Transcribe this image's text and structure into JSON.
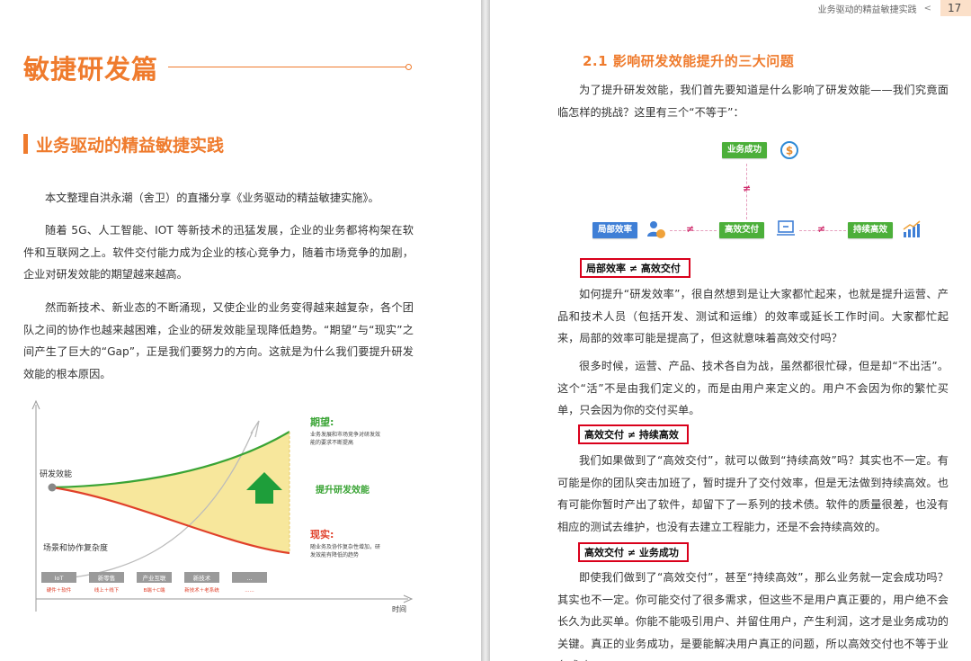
{
  "left_page": {
    "section_title": "敏捷研发篇",
    "chapter_title": "业务驱动的精益敏捷实践",
    "paragraphs": [
      "本文整理自洪永潮（舍卫）的直播分享《业务驱动的精益敏捷实施》。",
      "随着 5G、人工智能、IOT 等新技术的迅猛发展，企业的业务都将构架在软件和互联网之上。软件交付能力成为企业的核心竞争力，随着市场竞争的加剧，企业对研发效能的期望越来越高。",
      "然而新技术、新业态的不断涌现，又使企业的业务变得越来越复杂，各个团队之间的协作也越来越困难，企业的研发效能呈现降低趋势。“期望”与“现实”之间产生了巨大的“Gap”，正是我们要努力的方向。这就是为什么我们要提升研发效能的根本原因。"
    ],
    "figure": {
      "y_label": "研发效能",
      "x_label": "时间",
      "complexity_label": "场景和协作复杂度",
      "expectation_title": "期望:",
      "expectation_desc": [
        "业务发展和市场竞争对研发效",
        "能的要求不断提高"
      ],
      "gap_label": "提升研发效能",
      "reality_title": "现实:",
      "reality_desc": [
        "随业务及协作复杂性增加，研",
        "发效能有降低的趋势"
      ],
      "tags": [
        {
          "name": "IoT",
          "sub": "硬件＋软件"
        },
        {
          "name": "新零售",
          "sub": "线上＋线下"
        },
        {
          "name": "产业互联",
          "sub": "B端＋C端"
        },
        {
          "name": "新技术",
          "sub": "新技术＋老系统"
        },
        {
          "name": "...",
          "sub": "......"
        }
      ],
      "colors": {
        "expectation": "#3aa435",
        "reality": "#e0402a",
        "gap_fill": "#f7e79c",
        "tag": "#9a9a9a"
      }
    }
  },
  "right_page": {
    "header_title": "业务驱动的精益敏捷实践",
    "header_chevron": "<",
    "page_number": "17",
    "subheading": "2.1   影响研发效能提升的三大问题",
    "intro": "为了提升研发效能，我们首先要知道是什么影响了研发效能——我们究竟面临怎样的挑战？这里有三个“不等于”：",
    "diagram": {
      "top": "业务成功",
      "left": "局部效率",
      "middle": "高效交付",
      "right": "持续高效",
      "neq": "≠"
    },
    "boxes": [
      "局部效率 ≠ 高效交付",
      "高效交付 ≠ 持续高效",
      "高效交付 ≠ 业务成功"
    ],
    "paragraphs": [
      "如何提升“研发效率”，很自然想到是让大家都忙起来，也就是提升运营、产品和技术人员（包括开发、测试和运维）的效率或延长工作时间。大家都忙起来，局部的效率可能是提高了，但这就意味着高效交付吗？",
      "很多时候，运营、产品、技术各自为战，虽然都很忙碌，但是却“不出活”。这个“活”不是由我们定义的，而是由用户来定义的。用户不会因为你的繁忙买单，只会因为你的交付买单。",
      "我们如果做到了“高效交付”，就可以做到“持续高效”吗？其实也不一定。有可能是你的团队突击加班了，暂时提升了交付效率，但是无法做到持续高效。也有可能你暂时产出了软件，却留下了一系列的技术债。软件的质量很差，也没有相应的测试去维护，也没有去建立工程能力，还是不会持续高效的。",
      "即使我们做到了“高效交付”，甚至“持续高效”，那么业务就一定会成功吗？其实也不一定。你可能交付了很多需求，但这些不是用户真正要的，用户绝不会长久为此买单。你能不能吸引用户、并留住用户，产生利润，这才是业务成功的关键。真正的业务成功，是要能解决用户真正的问题，所以高效交付也不等于业务成功。"
    ]
  }
}
